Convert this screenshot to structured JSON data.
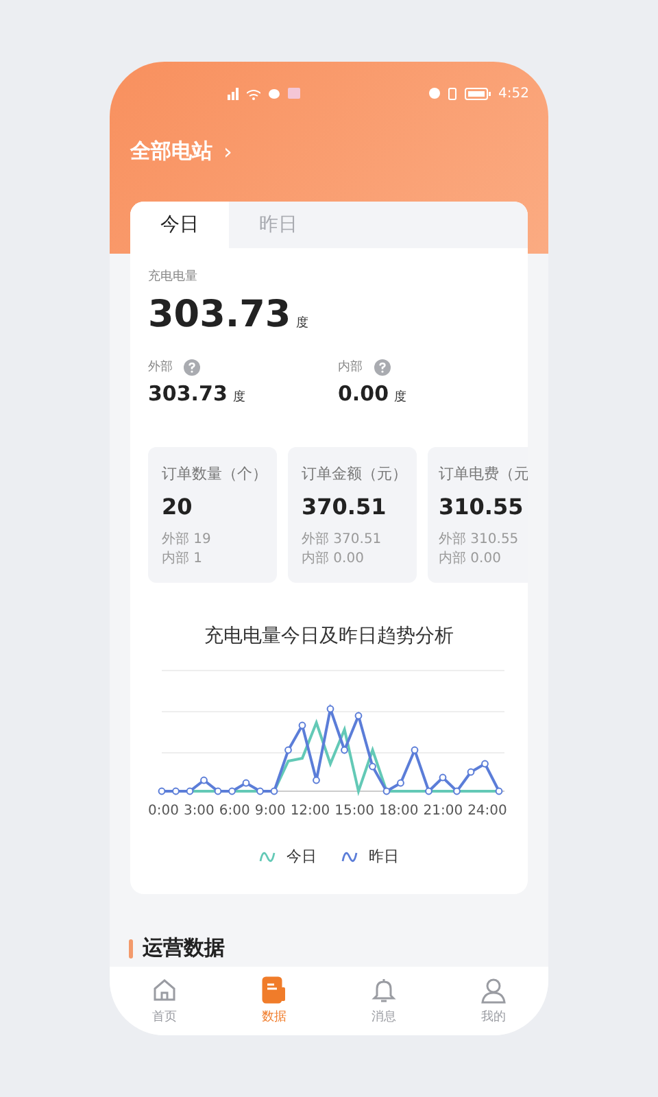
{
  "status_bar": {
    "time": "4:52"
  },
  "header": {
    "title": "全部电站",
    "chevron": "›"
  },
  "tabs": [
    {
      "label": "今日",
      "selected": true
    },
    {
      "label": "昨日",
      "selected": false
    }
  ],
  "charge": {
    "label": "充电电量",
    "value": "303.73",
    "unit": "度"
  },
  "split": [
    {
      "label": "外部",
      "value": "303.73",
      "unit": "度"
    },
    {
      "label": "内部",
      "value": "0.00",
      "unit": "度"
    }
  ],
  "stat_cards": [
    {
      "title": "订单数量（个）",
      "value": "20",
      "external": "外部 19",
      "internal": "内部 1"
    },
    {
      "title": "订单金额（元）",
      "value": "370.51",
      "external": "外部 370.51",
      "internal": "内部 0.00"
    },
    {
      "title": "订单电费（元",
      "value": "310.55",
      "external": "外部 310.55",
      "internal": "内部 0.00"
    }
  ],
  "trend": {
    "title": "充电电量今日及昨日趋势分析",
    "x_labels": [
      "0:00",
      "3:00",
      "6:00",
      "9:00",
      "12:00",
      "15:00",
      "18:00",
      "21:00",
      "24:00"
    ],
    "legend": [
      {
        "label": "今日",
        "color": "#63c9b6"
      },
      {
        "label": "昨日",
        "color": "#5b7dd8"
      }
    ]
  },
  "section": {
    "title": "运营数据"
  },
  "nav": [
    {
      "label": "首页",
      "selected": false
    },
    {
      "label": "数据",
      "selected": true
    },
    {
      "label": "消息",
      "selected": false
    },
    {
      "label": "我的",
      "selected": false
    }
  ]
}
